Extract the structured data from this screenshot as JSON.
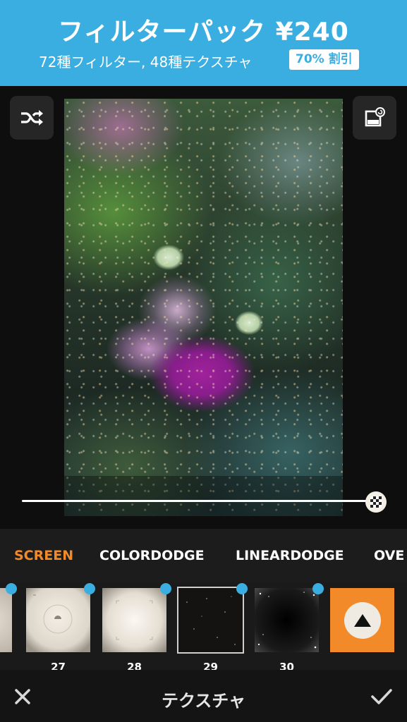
{
  "banner": {
    "title": "フィルターパック ¥240",
    "subtitle": "72種フィルター, 48種テクスチャ",
    "badge": "70% 割引"
  },
  "editor": {
    "shuffle_icon": "shuffle-icon",
    "rotate_icon": "rotate-frame-icon",
    "slider_value": 1.0,
    "slider_knob_icon": "checker-icon"
  },
  "blend_modes": {
    "active": "SCREEN",
    "items": [
      "SCREEN",
      "COLORDODGE",
      "LINEARDODGE",
      "OVE"
    ]
  },
  "textures": {
    "items": [
      {
        "number": "27",
        "selected_indicator": true
      },
      {
        "number": "28",
        "selected_indicator": true
      },
      {
        "number": "29",
        "selected_indicator": true
      },
      {
        "number": "30",
        "selected_indicator": true
      }
    ],
    "expand_icon": "triangle-up-icon"
  },
  "bottom_bar": {
    "title": "テクスチャ",
    "close_icon": "close-icon",
    "confirm_icon": "checkmark-icon"
  },
  "colors": {
    "banner": "#3aaee0",
    "accent_orange": "#f28a2a",
    "dot_blue": "#3aaee0"
  }
}
